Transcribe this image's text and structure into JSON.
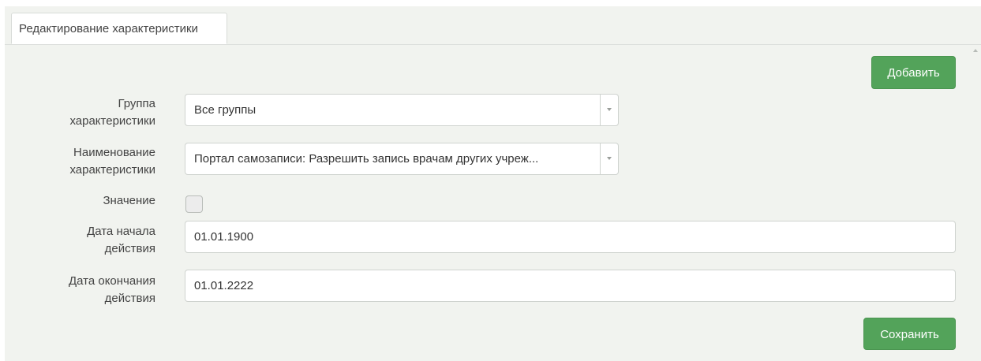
{
  "tab": {
    "title": "Редактирование характеристики"
  },
  "buttons": {
    "add_label": "Добавить",
    "save_label": "Сохранить"
  },
  "form": {
    "group": {
      "label_line1": "Группа",
      "label_line2": "характеристики",
      "value": "Все группы"
    },
    "name": {
      "label_line1": "Наименование",
      "label_line2": "характеристики",
      "value": "Портал самозаписи: Разрешить запись врачам других учреж..."
    },
    "value": {
      "label": "Значение",
      "checked": false
    },
    "start_date": {
      "label_line1": "Дата начала",
      "label_line2": "действия",
      "value": "01.01.1900"
    },
    "end_date": {
      "label_line1": "Дата окончания",
      "label_line2": "действия",
      "value": "01.01.2222"
    }
  },
  "colors": {
    "primary_button": "#53a35a",
    "panel_background": "#f1f3ef"
  }
}
